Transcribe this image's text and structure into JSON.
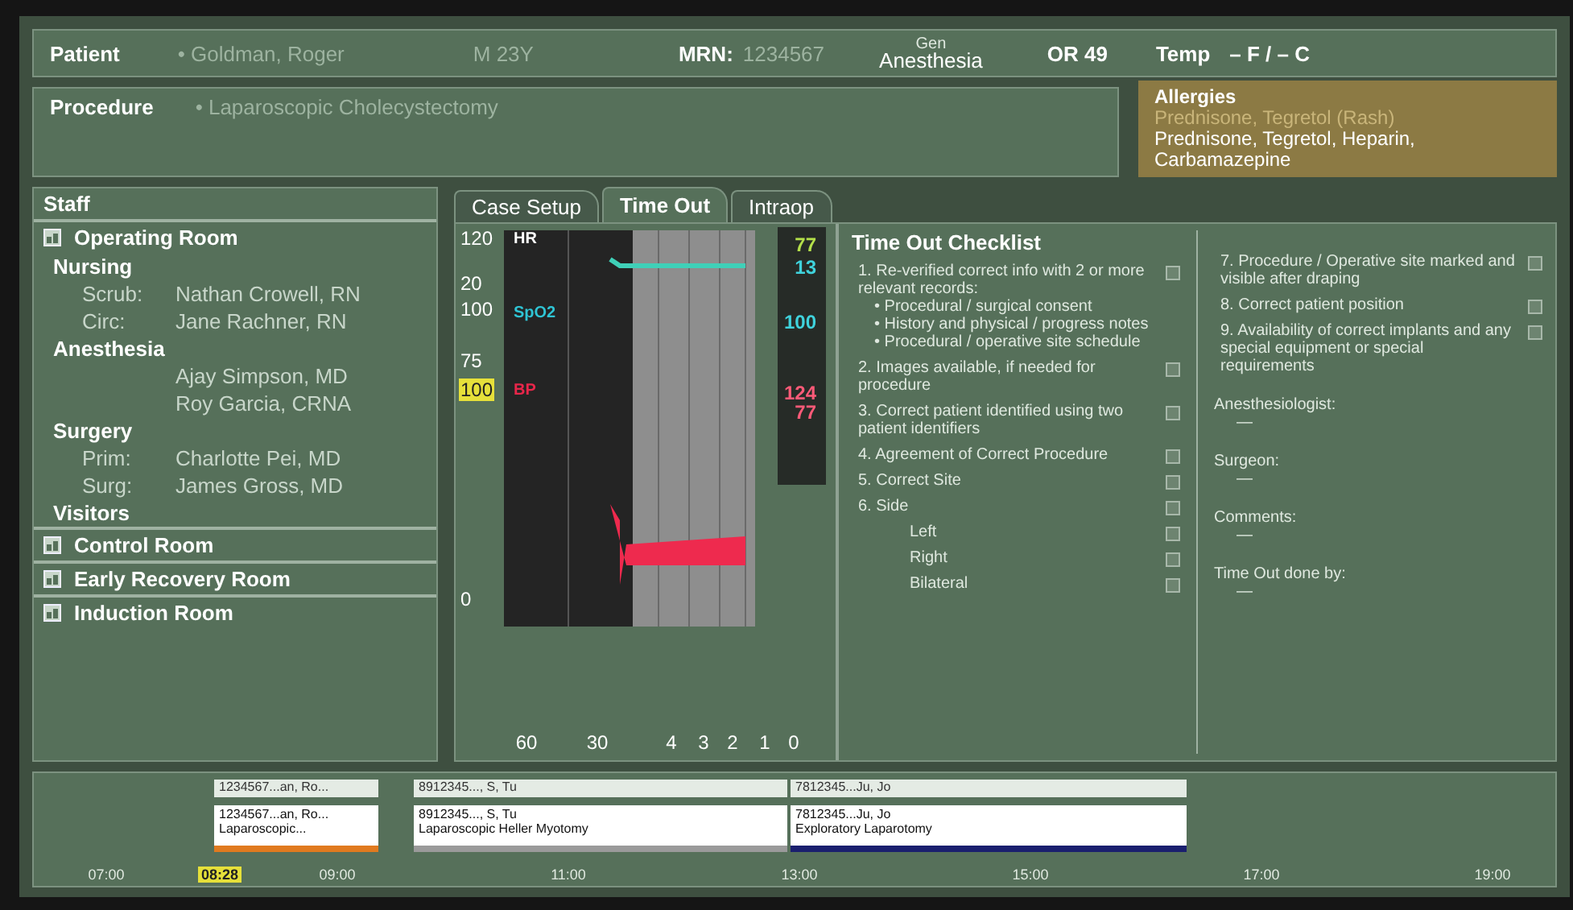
{
  "header": {
    "patient_label": "Patient",
    "patient_name": "• Goldman, Roger",
    "sex_age": "M 23Y",
    "mrn_label": "MRN:",
    "mrn": "1234567",
    "anesthesia_top": "Gen",
    "anesthesia": "Anesthesia",
    "room": "OR 49",
    "temp_label": "Temp",
    "temp": "– F /  – C"
  },
  "procedure": {
    "label": "Procedure",
    "value": "• Laparoscopic Cholecystectomy"
  },
  "allergies": {
    "title": "Allergies",
    "previous": "Prednisone, Tegretol (Rash)",
    "current": "Prednisone, Tegretol, Heparin, Carbamazepine"
  },
  "staff": {
    "title": "Staff",
    "rooms": [
      {
        "name": "Operating Room",
        "groups": [
          {
            "name": "Nursing",
            "members": [
              {
                "role": "Scrub:",
                "name": "Nathan Crowell, RN"
              },
              {
                "role": "Circ:",
                "name": "Jane Rachner, RN"
              }
            ]
          },
          {
            "name": "Anesthesia",
            "members": [
              {
                "name": "Ajay Simpson, MD"
              },
              {
                "name": "Roy Garcia, CRNA"
              }
            ]
          },
          {
            "name": "Surgery",
            "members": [
              {
                "role": "Prim:",
                "name": "Charlotte Pei, MD"
              },
              {
                "role": "Surg:",
                "name": "James Gross, MD"
              }
            ]
          },
          {
            "name": "Visitors"
          }
        ]
      },
      {
        "name": "Control Room"
      },
      {
        "name": "Early Recovery Room"
      },
      {
        "name": "Induction Room"
      }
    ]
  },
  "tabs": [
    {
      "label": "Case Setup",
      "selected": false
    },
    {
      "label": "Time Out",
      "selected": true
    },
    {
      "label": "Intraop",
      "selected": false
    }
  ],
  "monitor": {
    "y_labels": [
      {
        "text": "120",
        "kind": "plain"
      },
      {
        "text": "20",
        "kind": "plain"
      },
      {
        "text": "100",
        "kind": "plain"
      },
      {
        "text": "75",
        "kind": "plain"
      },
      {
        "text": "100",
        "kind": "highlight"
      },
      {
        "text": "0",
        "kind": "plain"
      }
    ],
    "series": [
      {
        "name": "HR",
        "color": "#ffffff"
      },
      {
        "name": "SpO2",
        "color": "#2fc4d4"
      },
      {
        "name": "BP",
        "color": "#e8264a"
      }
    ],
    "readings": [
      {
        "text": "77",
        "color": "#b4e04a"
      },
      {
        "text": "13",
        "color": "#3fd2dc"
      },
      {
        "text": "100",
        "color": "#3fd2dc"
      },
      {
        "text": "124",
        "color": "#ff5a78"
      },
      {
        "text": "77",
        "color": "#ff5a78"
      }
    ],
    "x_labels": [
      "60",
      "30",
      "4",
      "3",
      "2",
      "1",
      "0"
    ]
  },
  "checklist": {
    "title": "Time Out Checklist",
    "left": [
      {
        "kind": "item",
        "number": "1.",
        "text": "Re-verified correct info with 2 or more relevant records:",
        "checked": false,
        "bullets": [
          "• Procedural / surgical consent",
          "• History and physical / progress notes",
          "• Procedural / operative site schedule"
        ]
      },
      {
        "kind": "item",
        "number": "2.",
        "text": "Images available, if needed for procedure",
        "checked": false
      },
      {
        "kind": "item",
        "number": "3.",
        "text": "Correct patient identified using two patient identifiers",
        "checked": false
      },
      {
        "kind": "item",
        "number": "4.",
        "text": "Agreement of Correct Procedure",
        "checked": false
      },
      {
        "kind": "item",
        "number": "5.",
        "text": "Correct Site",
        "checked": false
      },
      {
        "kind": "item",
        "number": "6.",
        "text": "Side",
        "checked": false
      },
      {
        "kind": "sub",
        "text": "Left",
        "checked": false
      },
      {
        "kind": "sub",
        "text": "Right",
        "checked": false
      },
      {
        "kind": "sub",
        "text": "Bilateral",
        "checked": false
      }
    ],
    "right": [
      {
        "kind": "item",
        "number": "7.",
        "text": "Procedure / Operative site marked and visible after draping",
        "checked": false
      },
      {
        "kind": "item",
        "number": "8.",
        "text": "Correct patient position",
        "checked": false
      },
      {
        "kind": "item",
        "number": "9.",
        "text": "Availability of correct implants and any special equipment or special requirements",
        "checked": false
      }
    ],
    "fields": [
      {
        "label": "Anesthesiologist:",
        "value": "—"
      },
      {
        "label": "Surgeon:",
        "value": "—"
      },
      {
        "label": "Comments:",
        "value": "—"
      },
      {
        "label": "Time Out done by:",
        "value": "—"
      }
    ]
  },
  "timeline": {
    "times": [
      "07:00",
      "09:00",
      "11:00",
      "13:00",
      "15:00",
      "17:00",
      "19:00"
    ],
    "now": "08:28",
    "cases": [
      {
        "tag": "1234567...an, Ro...",
        "id": "1234567...an, Ro...",
        "procedure": "Laparoscopic...",
        "color": "#e07a1f"
      },
      {
        "tag": "8912345..., S, Tu",
        "id": "8912345..., S, Tu",
        "procedure": "Laparoscopic Heller Myotomy",
        "color": "#9a9a9a"
      },
      {
        "tag": "7812345...Ju, Jo",
        "id": "7812345...Ju, Jo",
        "procedure": "Exploratory Laparotomy",
        "color": "#1a1f6e"
      }
    ]
  }
}
